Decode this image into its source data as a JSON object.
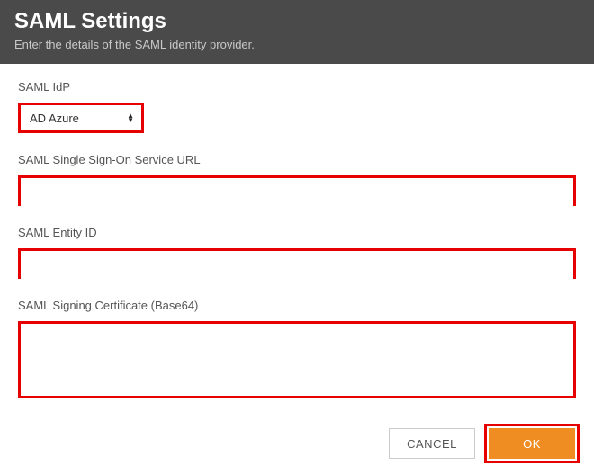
{
  "header": {
    "title": "SAML Settings",
    "subtitle": "Enter the details of the SAML identity provider."
  },
  "fields": {
    "idp": {
      "label": "SAML IdP",
      "value": "AD Azure"
    },
    "sso_url": {
      "label": "SAML Single Sign-On Service URL",
      "value": ""
    },
    "entity_id": {
      "label": "SAML Entity ID",
      "value": ""
    },
    "signing_cert": {
      "label": "SAML Signing Certificate (Base64)",
      "value": ""
    }
  },
  "buttons": {
    "cancel": "CANCEL",
    "ok": "OK"
  },
  "colors": {
    "highlight_border": "#e60000",
    "primary_button": "#ef8d22",
    "header_bg": "#4a4a4a"
  }
}
